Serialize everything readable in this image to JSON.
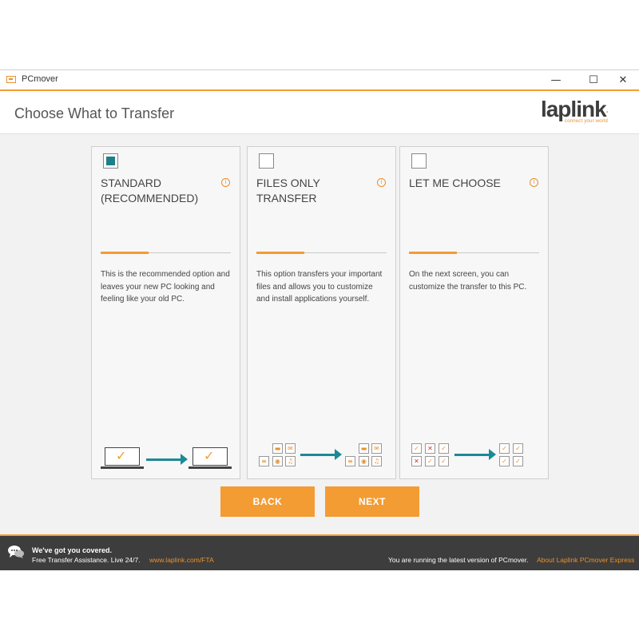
{
  "window": {
    "title": "PCmover",
    "controls": {
      "minimize": "—",
      "maximize": "☐",
      "close": "✕"
    }
  },
  "header": {
    "page_title": "Choose What to Transfer",
    "logo_text": "laplink",
    "logo_tagline": "connect your world"
  },
  "colors": {
    "accent": "#f39c33",
    "teal": "#1c8a96",
    "footer_bg": "#3d3d3d"
  },
  "cards": [
    {
      "title": "STANDARD (RECOMMENDED)",
      "checked": true,
      "description": "This is the recommended option and leaves your new PC looking and feeling like your old PC.",
      "icon": "info-icon"
    },
    {
      "title": "FILES ONLY TRANSFER",
      "checked": false,
      "description": "This option transfers your important files and allows you to customize and install applications yourself.",
      "icon": "info-icon"
    },
    {
      "title": "LET ME CHOOSE",
      "checked": false,
      "description": "On the next screen, you can customize the transfer to this PC.",
      "icon": "info-icon"
    }
  ],
  "buttons": {
    "back": "BACK",
    "next": "NEXT"
  },
  "footer": {
    "headline": "We've got you covered.",
    "subline": "Free Transfer Assistance. Live 24/7.",
    "link": "www.laplink.com/FTA",
    "status": "You are running the latest version of PCmover.",
    "about": "About Laplink PCmover Express"
  }
}
